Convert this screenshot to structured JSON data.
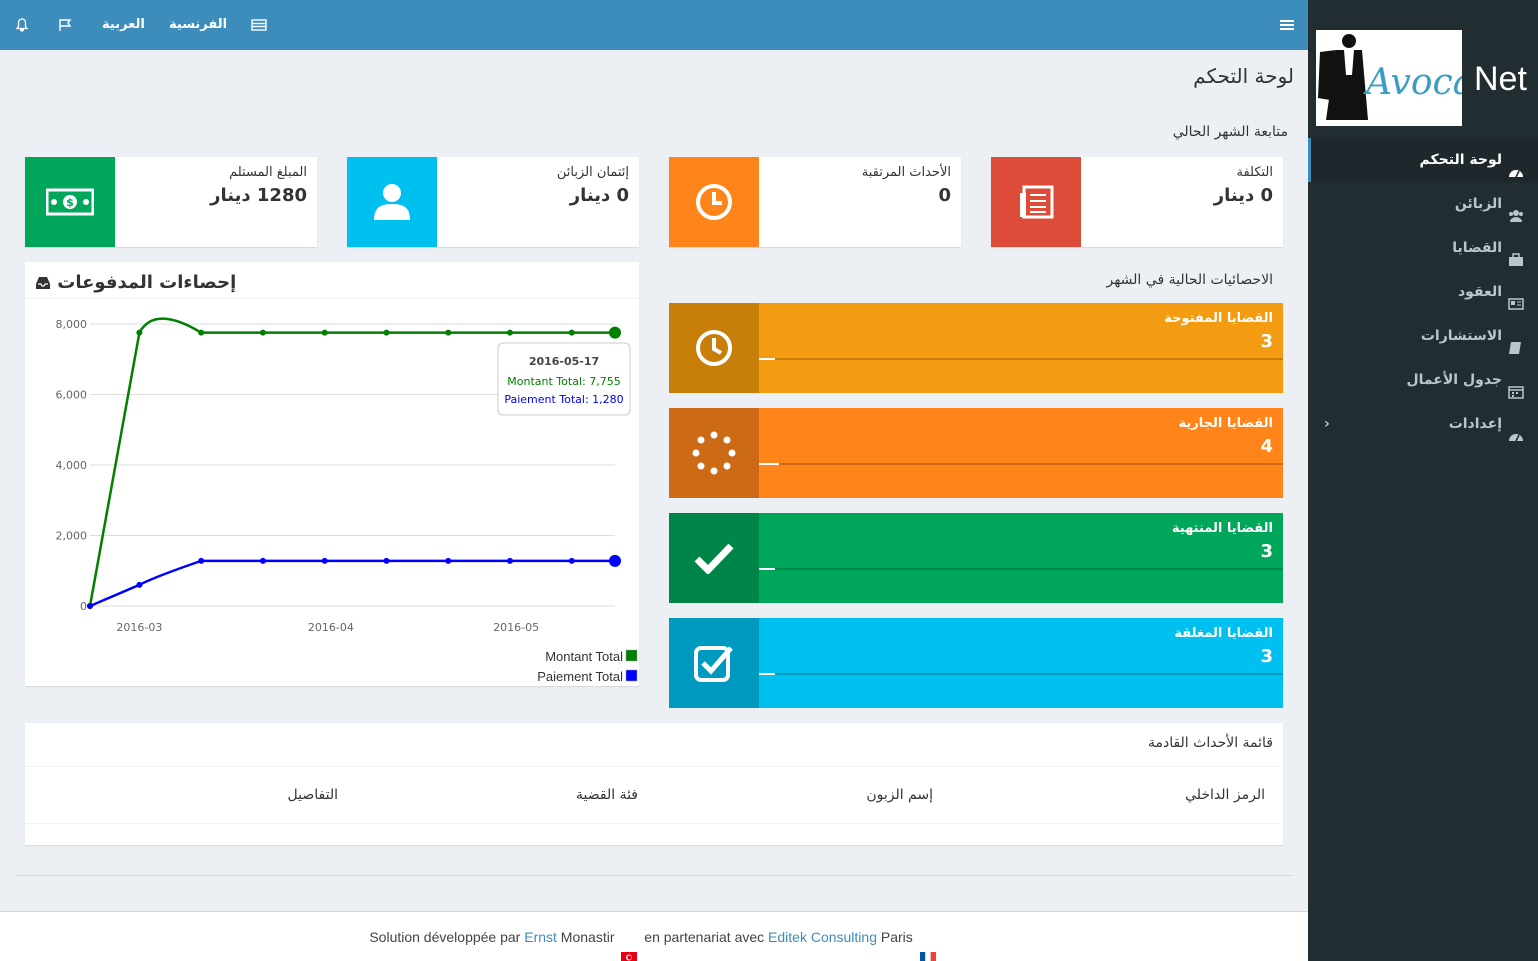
{
  "topbar": {
    "lang_ar": "العربية",
    "lang_fr": "الفرنسية"
  },
  "brand": {
    "logo_text": "Avoca",
    "suffix": "Net"
  },
  "sidebar": {
    "items": [
      {
        "label": "لوحة التحكم",
        "icon": "dashboard-icon"
      },
      {
        "label": "الزبائن",
        "icon": "users-icon"
      },
      {
        "label": "القضايا",
        "icon": "briefcase-icon"
      },
      {
        "label": "العقود",
        "icon": "newspaper-icon"
      },
      {
        "label": "الاستشارات",
        "icon": "book-icon"
      },
      {
        "label": "جدول الأعمال",
        "icon": "calendar-icon"
      },
      {
        "label": "إعدادات",
        "icon": "dashboard-icon"
      }
    ]
  },
  "page": {
    "title": "لوحة التحكم",
    "month_section": "متابعة الشهر الحالي",
    "stats_section": "الاحصائيات الحالية في الشهر"
  },
  "info_boxes": [
    {
      "label": "التكلفة",
      "value": "0 دينار",
      "color": "#dd4b39"
    },
    {
      "label": "الأحداث المرتقبة",
      "value": "0",
      "color": "#ff851b"
    },
    {
      "label": "إئتمان الزبائن",
      "value": "0 دينار",
      "color": "#00c0ef"
    },
    {
      "label": "المبلغ المستلم",
      "value": "1280 دينار",
      "color": "#00a65a"
    }
  ],
  "stat_boxes": [
    {
      "label": "القضايا المفتوحة",
      "value": "3",
      "color": "#f39c12"
    },
    {
      "label": "القضايا الجارية",
      "value": "4",
      "color": "#ff851b"
    },
    {
      "label": "القضايا المنتهية",
      "value": "3",
      "color": "#00a65a"
    },
    {
      "label": "القضايا المغلقة",
      "value": "3",
      "color": "#00c0ef"
    }
  ],
  "chart_panel": {
    "title": "إحصاءات المدفوعات"
  },
  "chart_data": {
    "type": "line",
    "x": [
      "2016-02-22",
      "2016-03-01",
      "2016-03-11",
      "2016-03-21",
      "2016-03-31",
      "2016-04-10",
      "2016-04-20",
      "2016-04-30",
      "2016-05-10",
      "2016-05-17"
    ],
    "series": [
      {
        "name": "Montant Total",
        "color": "#008000",
        "values": [
          0,
          7755,
          7755,
          7755,
          7755,
          7755,
          7755,
          7755,
          7755,
          7755
        ]
      },
      {
        "name": "Paiement Total",
        "color": "#0000ff",
        "values": [
          0,
          600,
          1280,
          1280,
          1280,
          1280,
          1280,
          1280,
          1280,
          1280
        ]
      }
    ],
    "x_ticks": [
      "2016-03",
      "2016-04",
      "2016-05"
    ],
    "y_ticks": [
      "0",
      "2,000",
      "4,000",
      "6,000",
      "8,000"
    ],
    "ylim": [
      0,
      8000
    ],
    "grid": true,
    "legend": "bottom-right",
    "tooltip": {
      "date": "2016-05-17",
      "line1": "Montant Total: 7,755",
      "line2": "Paiement Total: 1,280"
    }
  },
  "events": {
    "title": "قائمة الأحداث القادمة",
    "columns": [
      "الرمز الداخلي",
      "إسم الزبون",
      "فئة القضية",
      "التفاصيل"
    ]
  },
  "footer": {
    "p1": "Solution développée par ",
    "link1": "Ernst",
    "p2": " Monastir ",
    "p3": " en partenariat avec ",
    "link2": "Editek Consulting",
    "p4": " Paris "
  }
}
